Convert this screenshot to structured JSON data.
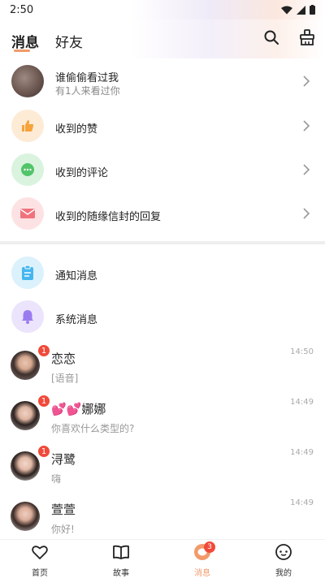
{
  "status_bar": {
    "time": "2:50"
  },
  "header": {
    "tabs": [
      {
        "label": "消息",
        "active": true
      },
      {
        "label": "好友",
        "active": false
      }
    ]
  },
  "interactions": [
    {
      "title": "谁偷偷看过我",
      "subtitle": "有1人来看过你",
      "icon": "blurred-avatar"
    },
    {
      "title": "收到的赞",
      "icon": "thumbs-up-icon",
      "color": "#f5a33a"
    },
    {
      "title": "收到的评论",
      "icon": "comment-icon",
      "color": "#52c46a"
    },
    {
      "title": "收到的随缘信封的回复",
      "icon": "envelope-icon",
      "color": "#f0737c"
    }
  ],
  "system": [
    {
      "title": "通知消息",
      "icon": "clipboard-icon",
      "color": "#46b6f0"
    },
    {
      "title": "系统消息",
      "icon": "bell-icon",
      "color": "#9b7cf0"
    }
  ],
  "chats": [
    {
      "name": "恋恋",
      "name_prefix": "",
      "preview": "[语音]",
      "time": "14:50",
      "badge": "1"
    },
    {
      "name": "娜娜",
      "name_prefix": "💕💕",
      "preview": "你喜欢什么类型的?",
      "time": "14:49",
      "badge": "1"
    },
    {
      "name": "浔鹭",
      "name_prefix": "",
      "preview": "嗨",
      "time": "14:49",
      "badge": "1"
    },
    {
      "name": "萱萱",
      "name_prefix": "",
      "preview": "你好!",
      "time": "14:49",
      "badge": ""
    }
  ],
  "bottom_nav": [
    {
      "label": "首页",
      "icon": "heart-icon"
    },
    {
      "label": "故事",
      "icon": "book-icon"
    },
    {
      "label": "消息",
      "icon": "message-icon",
      "active": true,
      "badge": "3"
    },
    {
      "label": "我的",
      "icon": "profile-icon"
    }
  ],
  "colors": {
    "accent": "#f29a6a",
    "badge": "#f04a3a"
  }
}
